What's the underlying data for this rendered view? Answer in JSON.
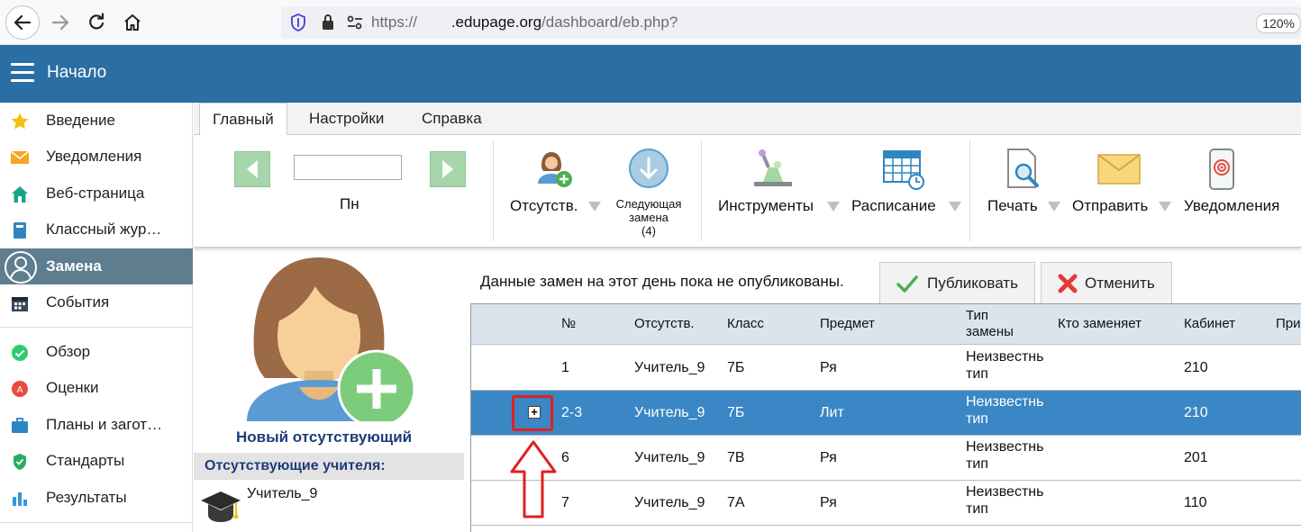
{
  "browser": {
    "url_prefix": "https://",
    "url_domain": ".edupage.org",
    "url_path": "/dashboard/eb.php?",
    "zoom": "120%"
  },
  "header": {
    "title": "Начало"
  },
  "sidebar": {
    "items": [
      {
        "label": "Введение",
        "icon": "star-icon"
      },
      {
        "label": "Уведомления",
        "icon": "envelope-icon"
      },
      {
        "label": "Веб-страница",
        "icon": "home-icon"
      },
      {
        "label": "Классный жур…",
        "icon": "notebook-icon"
      },
      {
        "label": "Замена",
        "icon": "user-circle-icon",
        "active": true
      },
      {
        "label": "События",
        "icon": "calendar-icon"
      },
      {
        "label": "Обзор",
        "icon": "check-circle-icon"
      },
      {
        "label": "Оценки",
        "icon": "grades-icon"
      },
      {
        "label": "Планы и загот…",
        "icon": "briefcase-icon"
      },
      {
        "label": "Стандарты",
        "icon": "shield-check-icon"
      },
      {
        "label": "Результаты",
        "icon": "bar-chart-icon"
      }
    ]
  },
  "ribbon": {
    "tabs": [
      "Главный",
      "Настройки",
      "Справка"
    ],
    "day_label": "Пн",
    "absences_label": "Отсутств.",
    "next_sub_line1": "Следующая",
    "next_sub_line2": "замена",
    "next_sub_count": "(4)",
    "tools_label": "Инструменты",
    "schedule_label": "Расписание",
    "print_label": "Печать",
    "send_label": "Отправить",
    "notifications_label": "Уведомления"
  },
  "left_panel": {
    "new_absent_label": "Новый отсутствующий",
    "absent_teachers_header": "Отсутствующие учителя:",
    "absent_teacher": "Учитель_9"
  },
  "main": {
    "notice": "Данные замен на этот день пока не опубликованы.",
    "publish_label": "Публиковать",
    "cancel_label": "Отменить",
    "columns": {
      "num": "№",
      "absent": "Отсутств.",
      "class": "Класс",
      "subject": "Предмет",
      "type_line1": "Тип",
      "type_line2": "замены",
      "replacer": "Кто заменяет",
      "room": "Кабинет",
      "note": "При"
    },
    "rows": [
      {
        "num": "1",
        "absent": "Учитель_9",
        "class": "7Б",
        "subject": "Ря",
        "type_line1": "Неизвестнь",
        "type_line2": "тип",
        "room": "210"
      },
      {
        "num": "2-3",
        "absent": "Учитель_9",
        "class": "7Б",
        "subject": "Лит",
        "type_line1": "Неизвестнь",
        "type_line2": "тип",
        "room": "210"
      },
      {
        "num": "6",
        "absent": "Учитель_9",
        "class": "7В",
        "subject": "Ря",
        "type_line1": "Неизвестнь",
        "type_line2": "тип",
        "room": "201"
      },
      {
        "num": "7",
        "absent": "Учитель_9",
        "class": "7А",
        "subject": "Ря",
        "type_line1": "Неизвестнь",
        "type_line2": "тип",
        "room": "110"
      }
    ],
    "expand_symbol": "+"
  },
  "colors": {
    "header_bg": "#2b6ea3",
    "sidebar_active": "#5e7d8e",
    "selected_row": "#3b86c4",
    "highlight_red": "#e02020"
  }
}
